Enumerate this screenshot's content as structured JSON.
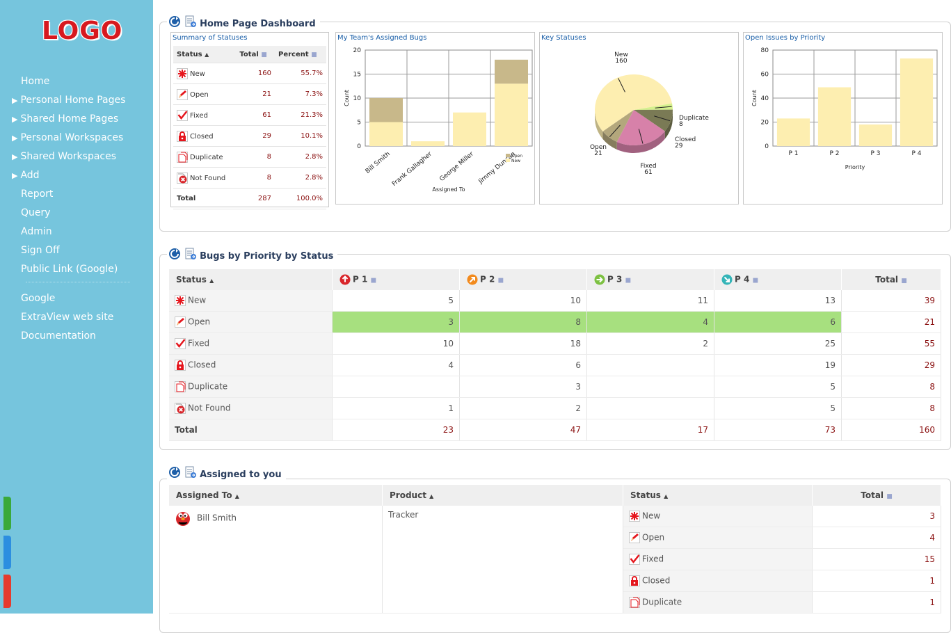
{
  "logo": "LOGO",
  "nav": {
    "items": [
      "Home",
      "Personal Home Pages",
      "Shared Home Pages",
      "Personal Workspaces",
      "Shared Workspaces",
      "Add",
      "Report",
      "Query",
      "Admin",
      "Sign Off",
      "Public Link (Google)"
    ],
    "links": [
      "Google",
      "ExtraView web site",
      "Documentation"
    ]
  },
  "dashboard": {
    "title": "Home Page Dashboard",
    "summary": {
      "title": "Summary of Statuses",
      "headers": [
        "Status",
        "Total",
        "Percent"
      ],
      "rows": [
        {
          "status": "New",
          "total": "160",
          "percent": "55.7%"
        },
        {
          "status": "Open",
          "total": "21",
          "percent": "7.3%"
        },
        {
          "status": "Fixed",
          "total": "61",
          "percent": "21.3%"
        },
        {
          "status": "Closed",
          "total": "29",
          "percent": "10.1%"
        },
        {
          "status": "Duplicate",
          "total": "8",
          "percent": "2.8%"
        },
        {
          "status": "Not Found",
          "total": "8",
          "percent": "2.8%"
        }
      ],
      "total_label": "Total",
      "total_value": "287",
      "total_percent": "100.0%"
    }
  },
  "chart_data": [
    {
      "type": "bar",
      "title": "My Team's Assigned Bugs",
      "categories": [
        "Bill Smith",
        "Frank Gallagher",
        "George Miller",
        "Jimmy Duncan"
      ],
      "series": [
        {
          "name": "Open",
          "values": [
            5,
            0,
            0,
            5
          ],
          "color": "#c8b88a"
        },
        {
          "name": "New",
          "values": [
            5,
            1,
            7,
            13
          ],
          "color": "#fdeeb0"
        }
      ],
      "xlabel": "Assigned To",
      "ylabel": "Count",
      "ylim": [
        0,
        20
      ],
      "yticks": [
        0,
        5,
        10,
        15,
        20
      ],
      "stacked": true,
      "legend": "bottom-right",
      "grid": true
    },
    {
      "type": "pie",
      "title": "Key Statuses",
      "labels": [
        "New",
        "Duplicate",
        "Closed",
        "Fixed",
        "Open"
      ],
      "values": [
        160,
        8,
        29,
        61,
        21
      ],
      "colors": [
        "#fdeeb0",
        "#d5f08d",
        "#7a7a55",
        "#d781a9",
        "#b3a77c"
      ]
    },
    {
      "type": "bar",
      "title": "Open Issues by Priority",
      "categories": [
        "P 1",
        "P 2",
        "P 3",
        "P 4"
      ],
      "values": [
        23,
        49,
        18,
        73
      ],
      "xlabel": "Priority",
      "ylabel": "Count",
      "ylim": [
        0,
        80
      ],
      "yticks": [
        0,
        20,
        40,
        60,
        80
      ],
      "grid": true,
      "color": "#fdeeb0"
    }
  ],
  "priority": {
    "title": "Bugs by Priority by Status",
    "headers": [
      "Status",
      "P 1",
      "P 2",
      "P 3",
      "P 4",
      "Total"
    ],
    "rows": [
      {
        "status": "New",
        "vals": [
          "5",
          "10",
          "11",
          "13"
        ],
        "total": "39"
      },
      {
        "status": "Open",
        "vals": [
          "3",
          "8",
          "4",
          "6"
        ],
        "total": "21"
      },
      {
        "status": "Fixed",
        "vals": [
          "10",
          "18",
          "2",
          "25"
        ],
        "total": "55"
      },
      {
        "status": "Closed",
        "vals": [
          "4",
          "6",
          "",
          "19"
        ],
        "total": "29"
      },
      {
        "status": "Duplicate",
        "vals": [
          "",
          "3",
          "",
          "5"
        ],
        "total": "8"
      },
      {
        "status": "Not Found",
        "vals": [
          "1",
          "2",
          "",
          "5"
        ],
        "total": "8"
      }
    ],
    "total_label": "Total",
    "totals": [
      "23",
      "47",
      "17",
      "73",
      "160"
    ]
  },
  "assigned": {
    "title": "Assigned to you",
    "headers": [
      "Assigned To",
      "Product",
      "Status",
      "Total"
    ],
    "user": "Bill Smith",
    "product": "Tracker",
    "rows": [
      {
        "status": "New",
        "total": "3"
      },
      {
        "status": "Open",
        "total": "4"
      },
      {
        "status": "Fixed",
        "total": "15"
      },
      {
        "status": "Closed",
        "total": "1"
      },
      {
        "status": "Duplicate",
        "total": "1"
      }
    ]
  }
}
